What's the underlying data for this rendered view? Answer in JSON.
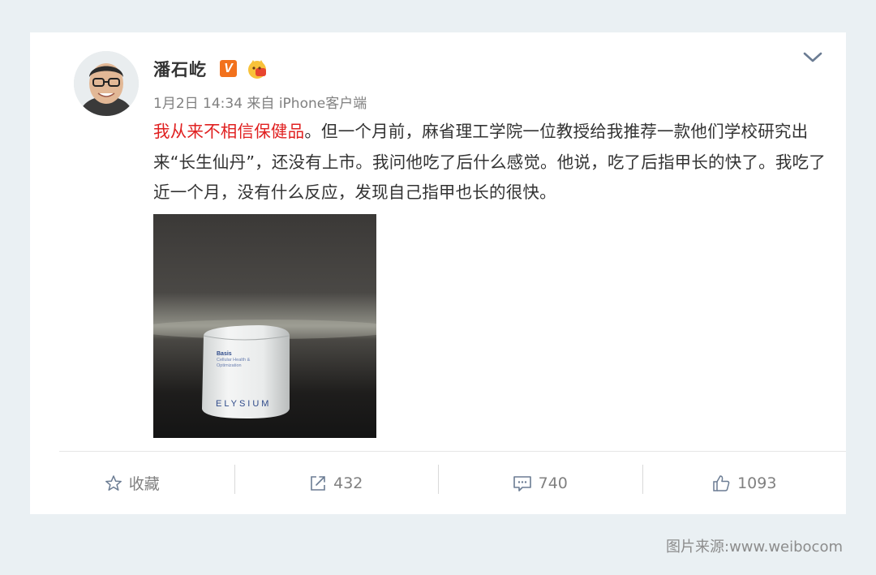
{
  "post": {
    "author": "潘石屹",
    "badge_v": "V",
    "meta": "1月2日 14:34 来自 iPhone客户端",
    "text_highlight": "我从来不相信保健品",
    "text_body": "。但一个月前，麻省理工学院一位教授给我推荐一款他们学校研究出来“长生仙丹”，还没有上市。我问他吃了后什么感觉。他说，吃了后指甲长的快了。我吃了近一个月，没有什么反应，发现自己指甲也长的很快。",
    "highlight_color": "#e02020",
    "image": {
      "product_brand": "ELYSIUM",
      "product_name": "Basis",
      "product_tagline": "Cellular Health &",
      "product_tagline2": "Optimization"
    }
  },
  "actions": {
    "favorite_label": "收藏",
    "repost_count": "432",
    "comment_count": "740",
    "like_count": "1093"
  },
  "icons": {
    "favorite": "star-outline-icon",
    "repost": "share-arrow-icon",
    "comment": "comment-bubble-icon",
    "like": "thumbs-up-icon",
    "menu": "chevron-down-icon"
  },
  "footer": {
    "source": "图片来源:www.weibocom"
  }
}
